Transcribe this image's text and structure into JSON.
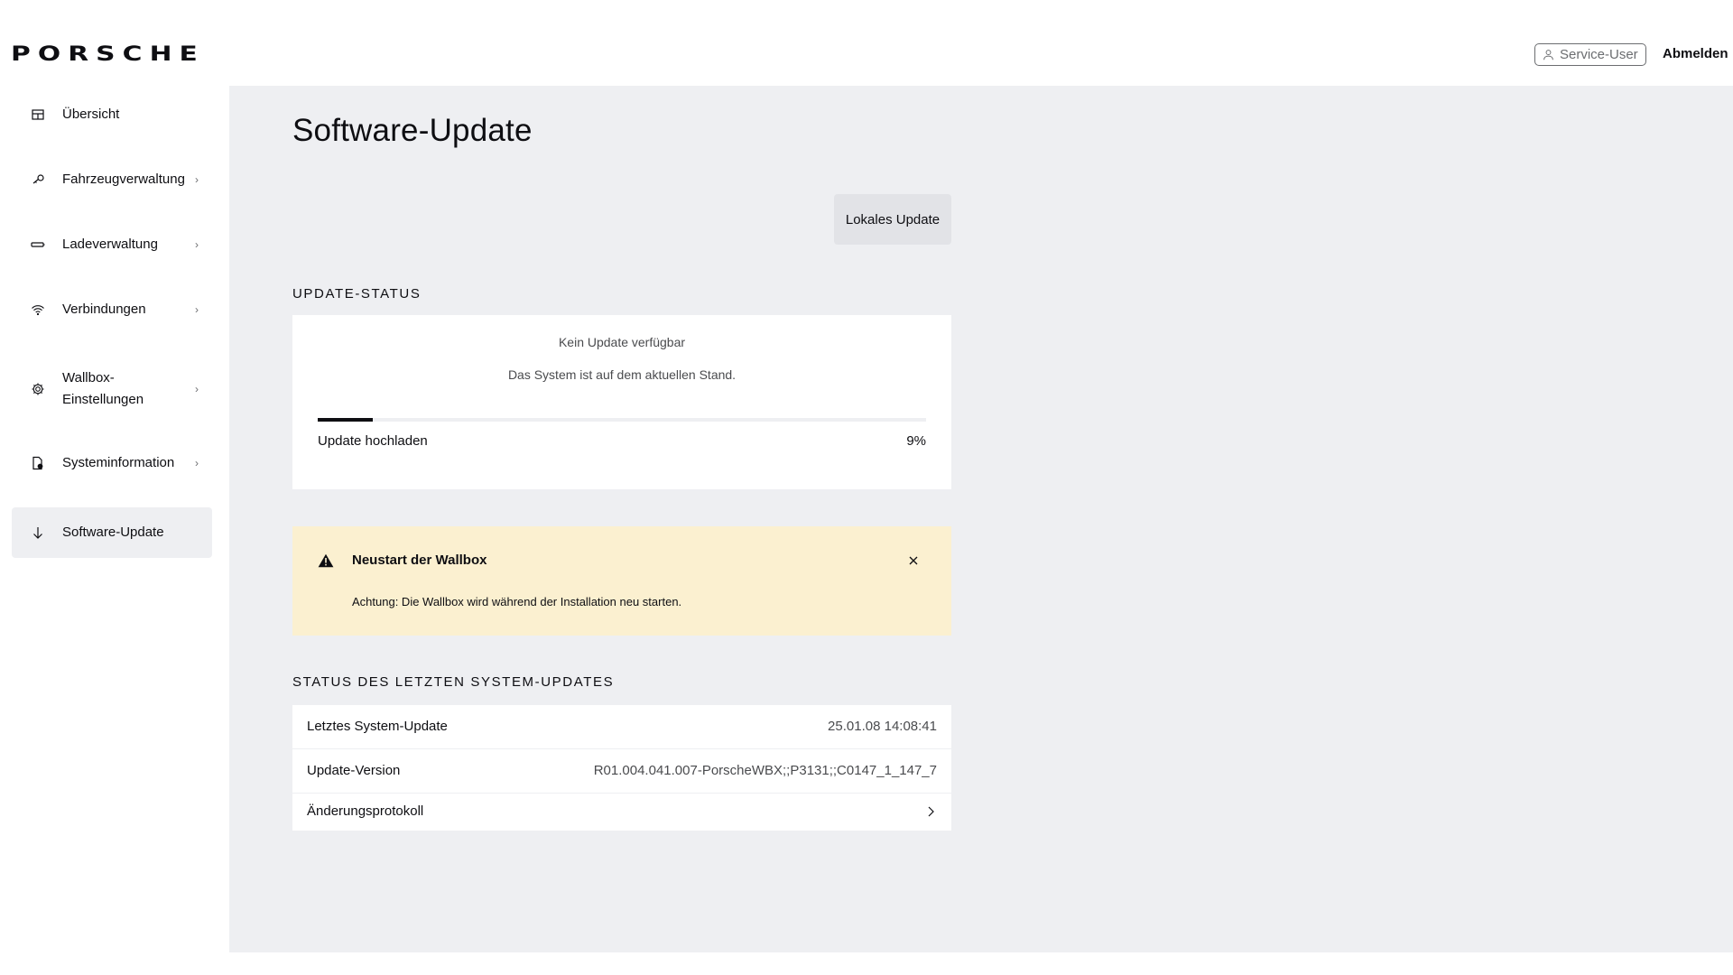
{
  "header": {
    "logo": "PORSCHE",
    "service_user": "Service-User",
    "logout": "Abmelden"
  },
  "sidebar": {
    "items": [
      {
        "label": "Übersicht",
        "icon": "dashboard-icon",
        "has_chevron": false
      },
      {
        "label": "Fahrzeugverwaltung",
        "icon": "car-key-icon",
        "has_chevron": true
      },
      {
        "label": "Ladeverwaltung",
        "icon": "battery-icon",
        "has_chevron": true
      },
      {
        "label": "Verbindungen",
        "icon": "wifi-icon",
        "has_chevron": true
      },
      {
        "label_line1": "Wallbox-",
        "label_line2": "Einstellungen",
        "icon": "gear-icon",
        "has_chevron": true
      },
      {
        "label": "Systeminformation",
        "icon": "document-info-icon",
        "has_chevron": true
      },
      {
        "label": "Software-Update",
        "icon": "download-arrow-icon",
        "has_chevron": false,
        "active": true
      }
    ],
    "chevron": "›"
  },
  "main": {
    "title": "Software-Update",
    "local_update_button": "Lokales Update",
    "update_status": {
      "heading": "UPDATE-STATUS",
      "title": "Kein Update verfügbar",
      "description": "Das System ist auf dem aktuellen Stand.",
      "progress_label": "Update hochladen",
      "progress_percent_text": "9%",
      "progress_value": 0.09
    },
    "warning": {
      "title": "Neustart der Wallbox",
      "text": "Achtung: Die Wallbox wird während der Installation neu starten.",
      "background": "#fbf0d0"
    },
    "last_update": {
      "heading": "STATUS DES LETZTEN SYSTEM-UPDATES",
      "rows": [
        {
          "key": "Letztes System-Update",
          "value": "25.01.08 14:08:41"
        },
        {
          "key": "Update-Version",
          "value": "R01.004.041.007-PorscheWBX;;P3131;;C0147_1_147_7"
        },
        {
          "key": "Änderungsprotokoll",
          "value": ""
        }
      ]
    }
  },
  "colors": {
    "background_main": "#eeeff2",
    "text": "#0e0e12",
    "muted": "#6b6d70"
  }
}
